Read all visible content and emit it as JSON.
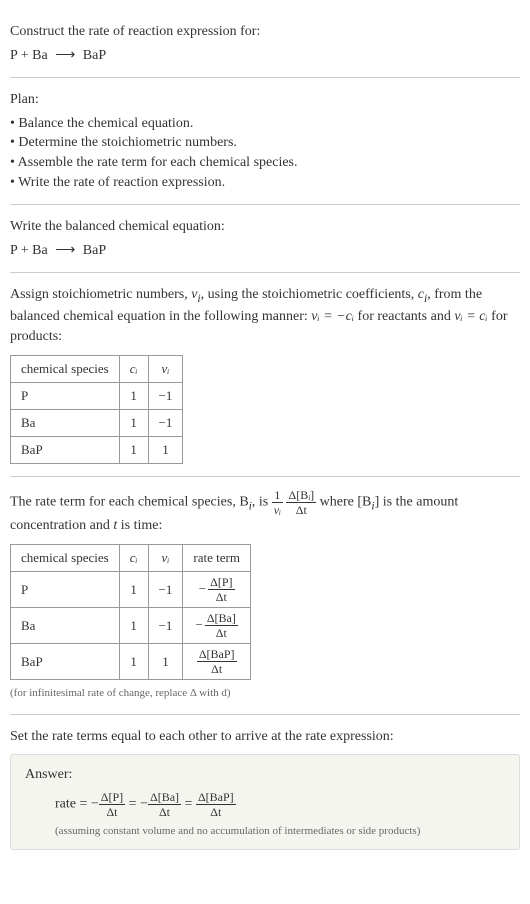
{
  "intro": {
    "prompt": "Construct the rate of reaction expression for:",
    "equation_left": "P + Ba",
    "equation_arrow": "⟶",
    "equation_right": "BaP"
  },
  "plan": {
    "label": "Plan:",
    "items": [
      "• Balance the chemical equation.",
      "• Determine the stoichiometric numbers.",
      "• Assemble the rate term for each chemical species.",
      "• Write the rate of reaction expression."
    ]
  },
  "balanced": {
    "label": "Write the balanced chemical equation:",
    "equation_left": "P + Ba",
    "equation_arrow": "⟶",
    "equation_right": "BaP"
  },
  "stoich": {
    "text_part1": "Assign stoichiometric numbers, ",
    "nu_i": "ν",
    "nu_sub": "i",
    "text_part2": ", using the stoichiometric coefficients, ",
    "c_i": "c",
    "c_sub": "i",
    "text_part3": ", from the balanced chemical equation in the following manner: ",
    "nu_eq_neg_c": "νᵢ = −cᵢ",
    "text_part4": " for reactants and ",
    "nu_eq_c": "νᵢ = cᵢ",
    "text_part5": " for products:",
    "table": {
      "headers": [
        "chemical species",
        "cᵢ",
        "νᵢ"
      ],
      "rows": [
        {
          "species": "P",
          "c": "1",
          "nu": "−1"
        },
        {
          "species": "Ba",
          "c": "1",
          "nu": "−1"
        },
        {
          "species": "BaP",
          "c": "1",
          "nu": "1"
        }
      ]
    }
  },
  "rateterm": {
    "text_part1": "The rate term for each chemical species, B",
    "sub_i": "i",
    "text_part2": ", is ",
    "frac1_num": "1",
    "frac1_den": "νᵢ",
    "frac2_num": "Δ[Bᵢ]",
    "frac2_den": "Δt",
    "text_part3": " where [B",
    "text_part4": "] is the amount concentration and ",
    "t_var": "t",
    "text_part5": " is time:",
    "table": {
      "headers": [
        "chemical species",
        "cᵢ",
        "νᵢ",
        "rate term"
      ],
      "rows": [
        {
          "species": "P",
          "c": "1",
          "nu": "−1",
          "rt_sign": "−",
          "rt_num": "Δ[P]",
          "rt_den": "Δt"
        },
        {
          "species": "Ba",
          "c": "1",
          "nu": "−1",
          "rt_sign": "−",
          "rt_num": "Δ[Ba]",
          "rt_den": "Δt"
        },
        {
          "species": "BaP",
          "c": "1",
          "nu": "1",
          "rt_sign": "",
          "rt_num": "Δ[BaP]",
          "rt_den": "Δt"
        }
      ]
    },
    "note": "(for infinitesimal rate of change, replace Δ with d)"
  },
  "final": {
    "label": "Set the rate terms equal to each other to arrive at the rate expression:"
  },
  "answer": {
    "label": "Answer:",
    "rate_label": "rate = ",
    "neg": "−",
    "eq": " = ",
    "term1_num": "Δ[P]",
    "term1_den": "Δt",
    "term2_num": "Δ[Ba]",
    "term2_den": "Δt",
    "term3_num": "Δ[BaP]",
    "term3_den": "Δt",
    "note": "(assuming constant volume and no accumulation of intermediates or side products)"
  }
}
